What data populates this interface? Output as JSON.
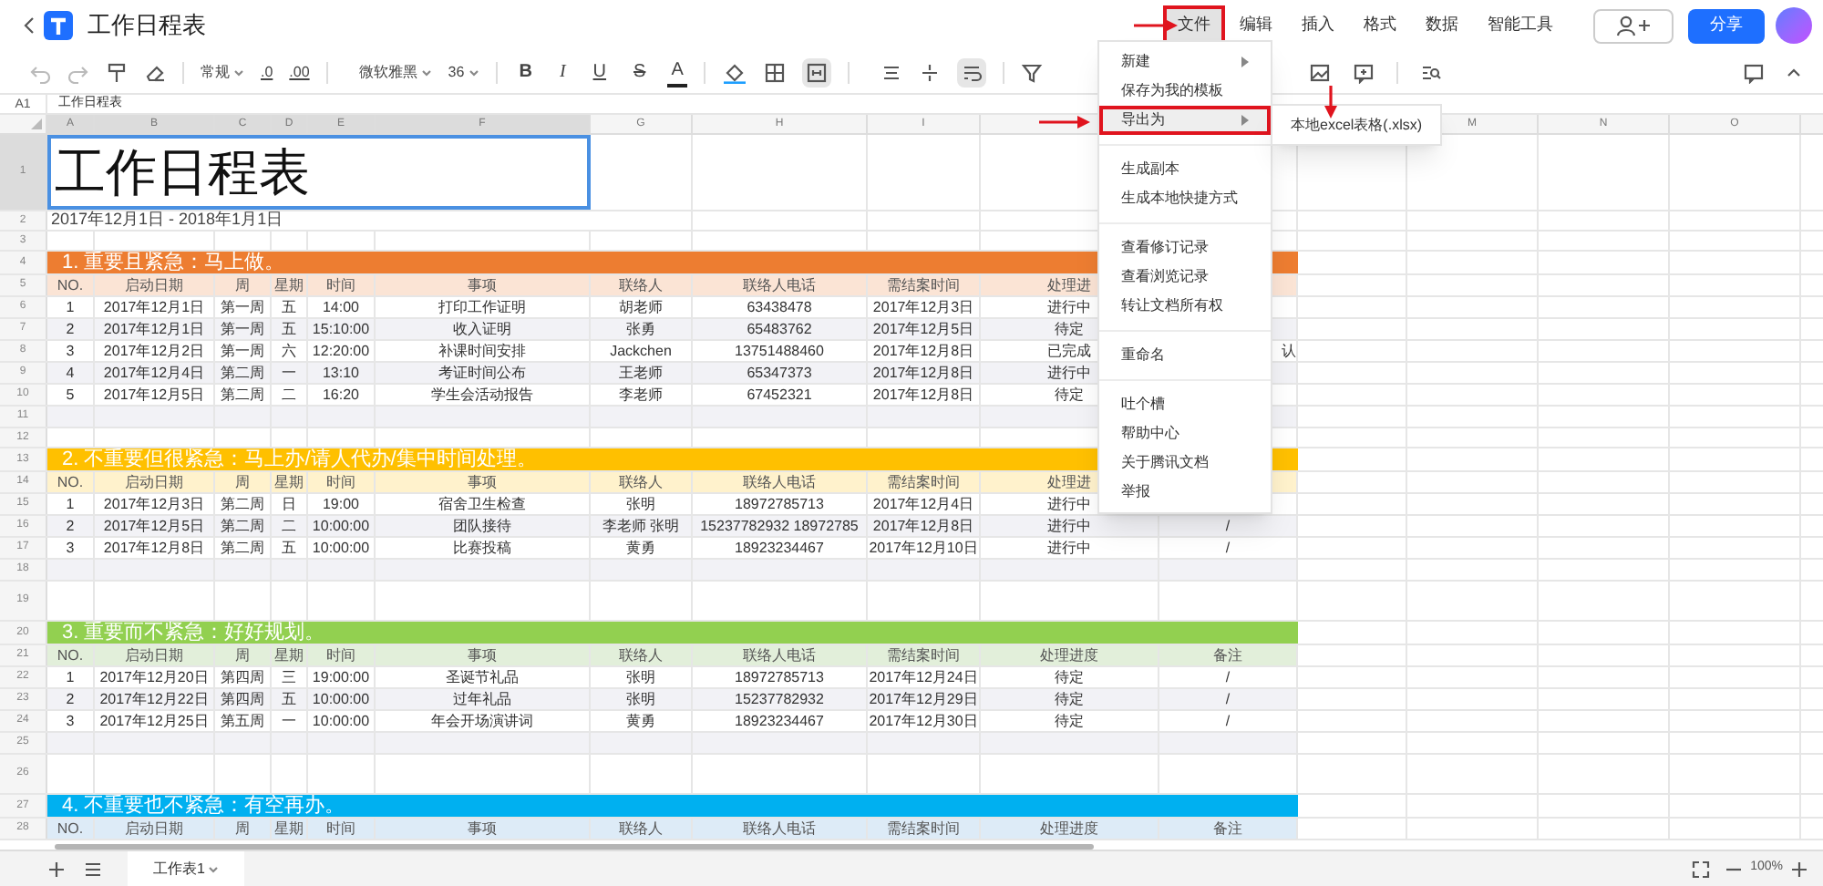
{
  "top_bar": {
    "title": "工作日程表",
    "menus": [
      {
        "label": "文件",
        "selected": true,
        "annotated": true
      },
      {
        "label": "编辑",
        "selected": false,
        "annotated": false
      },
      {
        "label": "插入",
        "selected": false,
        "annotated": false
      },
      {
        "label": "格式",
        "selected": false,
        "annotated": false
      },
      {
        "label": "数据",
        "selected": false,
        "annotated": false
      },
      {
        "label": "智能工具",
        "selected": false,
        "annotated": false
      }
    ],
    "share": "分享"
  },
  "toolbar": {
    "number_format": "常规",
    "decrease_decimals": ".0",
    "increase_decimals": ".00",
    "font": "微软雅黑",
    "font_size": "36",
    "bold": "B",
    "italic": "I",
    "underline": "U",
    "strikethrough": "S",
    "font_color": "A"
  },
  "formula_bar": {
    "cell": "A1",
    "value": "工作日程表"
  },
  "column_headers": [
    {
      "label": "A",
      "selected": true
    },
    {
      "label": "B",
      "selected": true
    },
    {
      "label": "C",
      "selected": true
    },
    {
      "label": "D",
      "selected": true
    },
    {
      "label": "E",
      "selected": true
    },
    {
      "label": "F",
      "selected": true
    },
    {
      "label": "G",
      "selected": false
    },
    {
      "label": "H",
      "selected": false
    },
    {
      "label": "I",
      "selected": false
    },
    {
      "label": "M",
      "selected": false
    },
    {
      "label": "N",
      "selected": false
    },
    {
      "label": "O",
      "selected": false
    }
  ],
  "rows": [
    {
      "number": "1",
      "kind": "title",
      "selected": true,
      "text": "工作日程表"
    },
    {
      "number": "2",
      "kind": "subtitle",
      "selected": false,
      "text": "2017年12月1日 - 2018年1月1日"
    },
    {
      "number": "3",
      "kind": "blank",
      "selected": false
    },
    {
      "number": "4",
      "kind": "section",
      "selected": false,
      "text": "1.  重要且紧急：马上做。",
      "color": "#ed7d31"
    },
    {
      "number": "5",
      "kind": "header",
      "selected": false,
      "color": "#fbe4d5",
      "cells": [
        "NO.",
        "启动日期",
        "周",
        "星期",
        "时间",
        "事项",
        "联络人",
        "联络人电话",
        "需结案时间",
        "处理进"
      ]
    },
    {
      "number": "6",
      "kind": "data",
      "selected": false,
      "cells": [
        "1",
        "2017年12月1日",
        "第一周",
        "五",
        "14:00",
        "打印工作证明",
        "胡老师",
        "63438478",
        "2017年12月3日",
        "进行中"
      ]
    },
    {
      "number": "7",
      "kind": "data",
      "selected": false,
      "cells": [
        "2",
        "2017年12月1日",
        "第一周",
        "五",
        "15:10:00",
        "收入证明",
        "张勇",
        "65483762",
        "2017年12月5日",
        "待定"
      ]
    },
    {
      "number": "8",
      "kind": "data",
      "selected": false,
      "cells": [
        "3",
        "2017年12月2日",
        "第一周",
        "六",
        "12:20:00",
        "补课时间安排",
        "Jackchen",
        "13751488460",
        "2017年12月8日",
        "已完成"
      ],
      "overflow": "认"
    },
    {
      "number": "9",
      "kind": "data",
      "selected": false,
      "cells": [
        "4",
        "2017年12月4日",
        "第二周",
        "一",
        "13:10",
        "考证时间公布",
        "王老师",
        "65347373",
        "2017年12月8日",
        "进行中"
      ]
    },
    {
      "number": "10",
      "kind": "data",
      "selected": false,
      "cells": [
        "5",
        "2017年12月5日",
        "第二周",
        "二",
        "16:20",
        "学生会活动报告",
        "李老师",
        "67452321",
        "2017年12月8日",
        "待定"
      ]
    },
    {
      "number": "11",
      "kind": "data",
      "selected": false
    },
    {
      "number": "12",
      "kind": "blank",
      "selected": false
    },
    {
      "number": "13",
      "kind": "section",
      "selected": false,
      "text": "2.  不重要但很紧急：马上办/请人代办/集中时间处理。",
      "color": "#ffc000"
    },
    {
      "number": "14",
      "kind": "header",
      "selected": false,
      "color": "#fff2cc",
      "cells": [
        "NO.",
        "启动日期",
        "周",
        "星期",
        "时间",
        "事项",
        "联络人",
        "联络人电话",
        "需结案时间",
        "处理进"
      ]
    },
    {
      "number": "15",
      "kind": "data",
      "selected": false,
      "cells": [
        "1",
        "2017年12月3日",
        "第二周",
        "日",
        "19:00",
        "宿舍卫生检查",
        "张明",
        "18972785713",
        "2017年12月4日",
        "进行中"
      ]
    },
    {
      "number": "16",
      "kind": "data",
      "selected": false,
      "cells": [
        "2",
        "2017年12月5日",
        "第二周",
        "二",
        "10:00:00",
        "团队接待",
        "李老师 张明",
        "15237782932 18972785",
        "2017年12月8日",
        "进行中",
        "/"
      ]
    },
    {
      "number": "17",
      "kind": "data",
      "selected": false,
      "cells": [
        "3",
        "2017年12月8日",
        "第二周",
        "五",
        "10:00:00",
        "比赛投稿",
        "黄勇",
        "18923234467",
        "2017年12月10日",
        "进行中",
        "/"
      ]
    },
    {
      "number": "18",
      "kind": "data",
      "selected": false
    },
    {
      "number": "19",
      "kind": "spacer",
      "selected": false
    },
    {
      "number": "20",
      "kind": "section",
      "selected": false,
      "text": "3.  重要而不紧急：好好规划。",
      "color": "#92d050"
    },
    {
      "number": "21",
      "kind": "header",
      "selected": false,
      "color": "#e2efda",
      "cells": [
        "NO.",
        "启动日期",
        "周",
        "星期",
        "时间",
        "事项",
        "联络人",
        "联络人电话",
        "需结案时间",
        "处理进度",
        "备注"
      ]
    },
    {
      "number": "22",
      "kind": "data",
      "selected": false,
      "cells": [
        "1",
        "2017年12月20日",
        "第四周",
        "三",
        "19:00:00",
        "圣诞节礼品",
        "张明",
        "18972785713",
        "2017年12月24日",
        "待定",
        "/"
      ]
    },
    {
      "number": "23",
      "kind": "data",
      "selected": false,
      "cells": [
        "2",
        "2017年12月22日",
        "第四周",
        "五",
        "10:00:00",
        "过年礼品",
        "张明",
        "15237782932",
        "2017年12月29日",
        "待定",
        "/"
      ]
    },
    {
      "number": "24",
      "kind": "data",
      "selected": false,
      "cells": [
        "3",
        "2017年12月25日",
        "第五周",
        "一",
        "10:00:00",
        "年会开场演讲词",
        "黄勇",
        "18923234467",
        "2017年12月30日",
        "待定",
        "/"
      ]
    },
    {
      "number": "25",
      "kind": "data",
      "selected": false
    },
    {
      "number": "26",
      "kind": "spacer",
      "selected": false
    },
    {
      "number": "27",
      "kind": "section",
      "selected": false,
      "text": "4.  不重要也不紧急：有空再办。",
      "color": "#00b0f0"
    },
    {
      "number": "28",
      "kind": "header",
      "selected": false,
      "color": "#ddebf7",
      "cells": [
        "NO.",
        "启动日期",
        "周",
        "星期",
        "时间",
        "事项",
        "联络人",
        "联络人电话",
        "需结案时间",
        "处理进度",
        "备注"
      ]
    }
  ],
  "file_menu": [
    {
      "kind": "item",
      "label": "新建",
      "submenu": true,
      "selected": false,
      "annotated": false
    },
    {
      "kind": "item",
      "label": "保存为我的模板",
      "submenu": false,
      "selected": false,
      "annotated": false
    },
    {
      "kind": "item",
      "label": "导出为",
      "submenu": true,
      "selected": true,
      "annotated": true
    },
    {
      "kind": "separator"
    },
    {
      "kind": "item",
      "label": "生成副本",
      "submenu": false,
      "selected": false,
      "annotated": false
    },
    {
      "kind": "item",
      "label": "生成本地快捷方式",
      "submenu": false,
      "selected": false,
      "annotated": false
    },
    {
      "kind": "separator"
    },
    {
      "kind": "item",
      "label": "查看修订记录",
      "submenu": false,
      "selected": false,
      "annotated": false
    },
    {
      "kind": "item",
      "label": "查看浏览记录",
      "submenu": false,
      "selected": false,
      "annotated": false
    },
    {
      "kind": "item",
      "label": "转让文档所有权",
      "submenu": false,
      "selected": false,
      "annotated": false
    },
    {
      "kind": "separator"
    },
    {
      "kind": "item",
      "label": "重命名",
      "submenu": false,
      "selected": false,
      "annotated": false
    },
    {
      "kind": "separator"
    },
    {
      "kind": "item",
      "label": "吐个槽",
      "submenu": false,
      "selected": false,
      "annotated": false
    },
    {
      "kind": "item",
      "label": "帮助中心",
      "submenu": false,
      "selected": false,
      "annotated": false
    },
    {
      "kind": "item",
      "label": "关于腾讯文档",
      "submenu": false,
      "selected": false,
      "annotated": false
    },
    {
      "kind": "item",
      "label": "举报",
      "submenu": false,
      "selected": false,
      "annotated": false
    }
  ],
  "export_submenu": [
    "本地excel表格(.xlsx)"
  ],
  "sheet_tabs": [
    {
      "label": "工作表1",
      "selected": true
    }
  ],
  "zoom": "100%"
}
